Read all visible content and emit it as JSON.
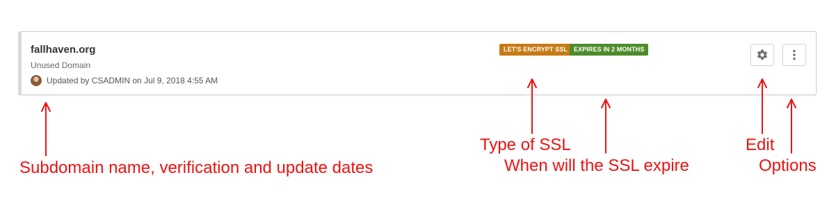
{
  "domain": {
    "name": "fallhaven.org",
    "status": "Unused Domain",
    "updated_text": "Updated by CSADMIN on Jul 9, 2018 4:55 AM"
  },
  "badges": {
    "ssl_type": "LET'S ENCRYPT SSL",
    "expiry": "EXPIRES IN 2 MONTHS"
  },
  "buttons": {
    "edit_icon": "gear-icon",
    "options_icon": "vertical-ellipsis-icon"
  },
  "annotations": {
    "subdomain": "Subdomain name, verification and update dates",
    "ssl_type": "Type of SSL",
    "ssl_expire": "When will the SSL expire",
    "edit": "Edit",
    "options": "Options"
  },
  "colors": {
    "ssl_badge": "#c67c16",
    "expiry_badge": "#4f8c2a",
    "annotation": "#ee1111"
  }
}
